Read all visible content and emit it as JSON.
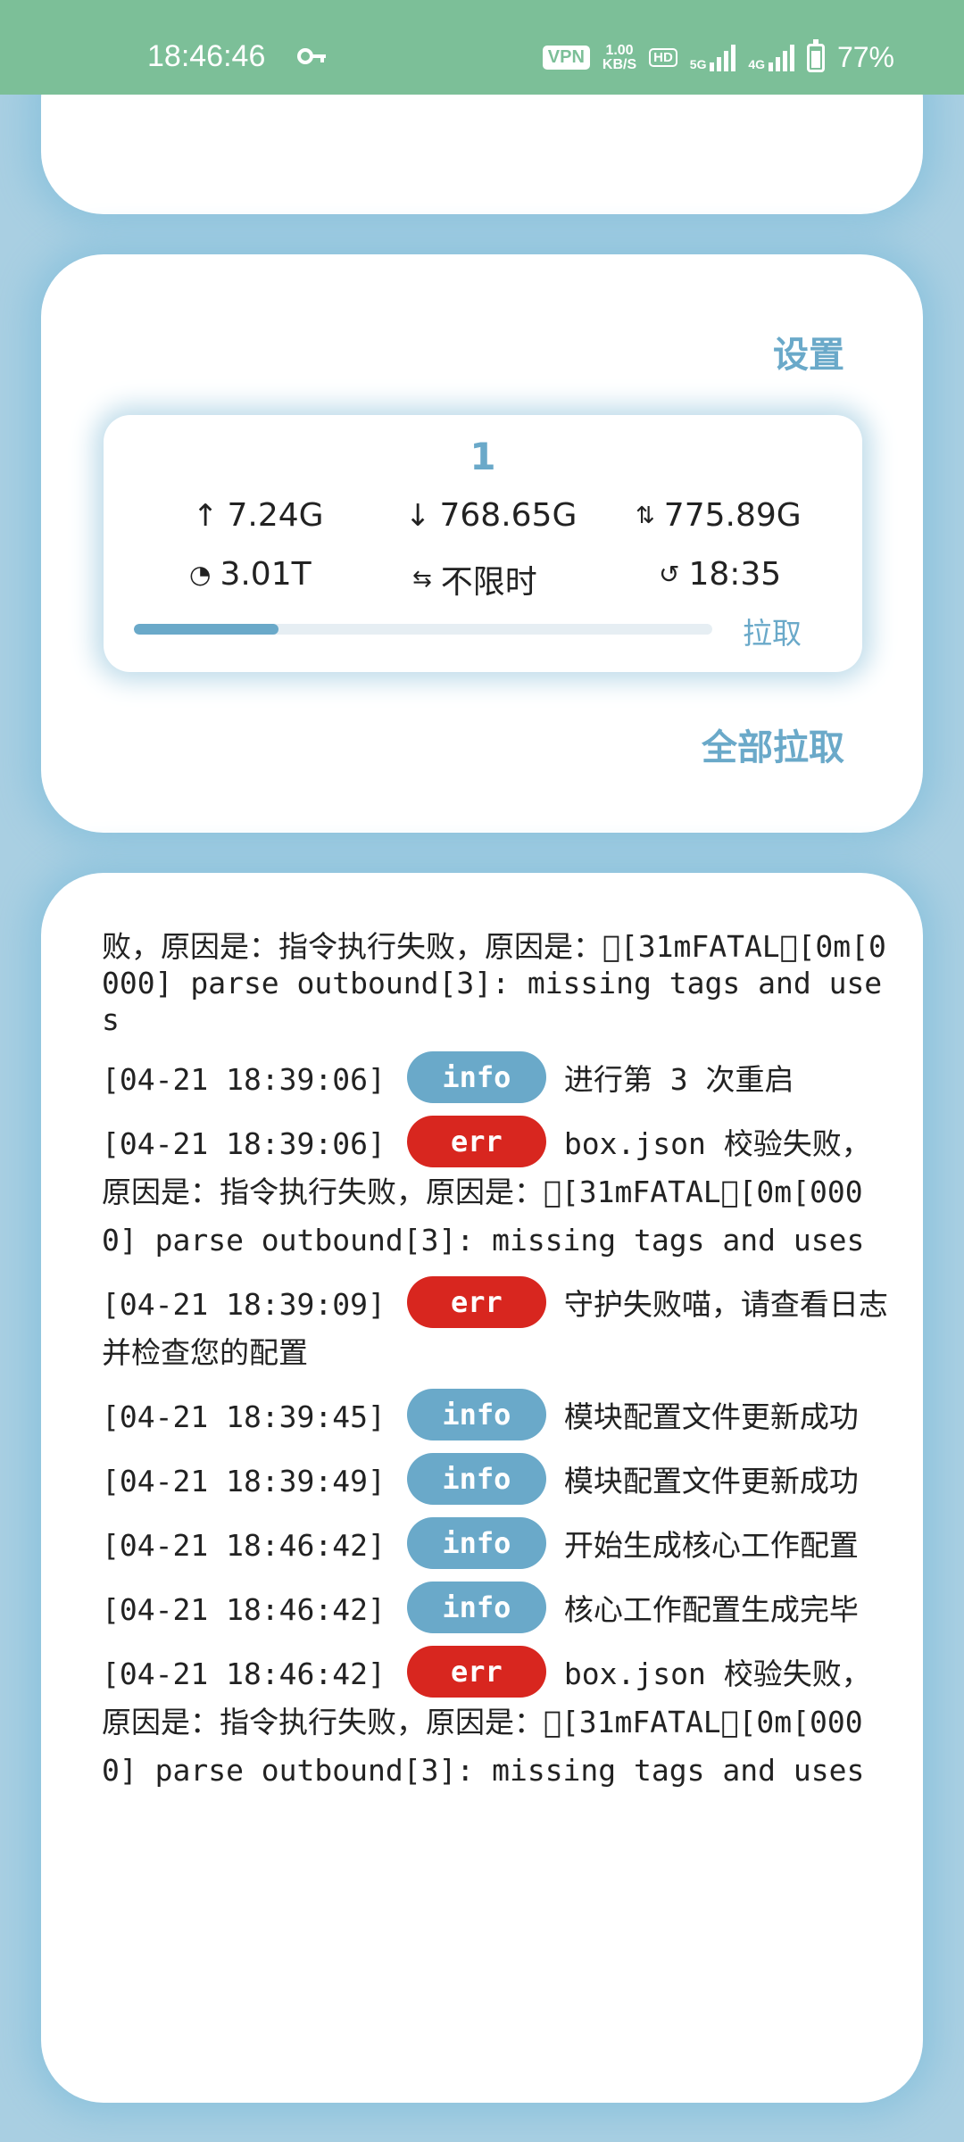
{
  "status_bar": {
    "time": "18:46:46",
    "vpn": "VPN",
    "speed_value": "1.00",
    "speed_unit": "KB/S",
    "hd": "HD",
    "net1": "5G",
    "net2": "4G",
    "battery": "77%"
  },
  "subscription": {
    "settings_label": "设置",
    "name": "1",
    "upload": "7.24G",
    "download": "768.65G",
    "used": "775.89G",
    "total": "3.01T",
    "expire": "不限时",
    "update_time": "18:35",
    "usage_fraction": 0.25,
    "pull_label": "拉取",
    "pull_all_label": "全部拉取"
  },
  "colors": {
    "accent": "#6aa9c9",
    "info": "#6aa9c9",
    "err": "#d8261f",
    "status_bar": "#7cbf98"
  },
  "logs": {
    "continuation": "败，原因是：指令执行失败，原因是：\u0000[31mFATAL\u0000[0m[0000] parse outbound[3]: missing tags and uses",
    "entries": [
      {
        "ts": "[04-21 18:39:06]",
        "level": "info",
        "msg": "进行第 3 次重启"
      },
      {
        "ts": "[04-21 18:39:06]",
        "level": "err",
        "msg": "box.json 校验失败，原因是：指令执行失败，原因是：\u0000[31mFATAL\u0000[0m[0000] parse outbound[3]: missing tags and uses"
      },
      {
        "ts": "[04-21 18:39:09]",
        "level": "err",
        "msg": "守护失败喵，请查看日志并检查您的配置"
      },
      {
        "ts": "[04-21 18:39:45]",
        "level": "info",
        "msg": "模块配置文件更新成功"
      },
      {
        "ts": "[04-21 18:39:49]",
        "level": "info",
        "msg": "模块配置文件更新成功"
      },
      {
        "ts": "[04-21 18:46:42]",
        "level": "info",
        "msg": "开始生成核心工作配置"
      },
      {
        "ts": "[04-21 18:46:42]",
        "level": "info",
        "msg": "核心工作配置生成完毕"
      },
      {
        "ts": "[04-21 18:46:42]",
        "level": "err",
        "msg": "box.json 校验失败，原因是：指令执行失败，原因是：\u0000[31mFATAL\u0000[0m[0000] parse outbound[3]: missing tags and uses"
      }
    ]
  }
}
